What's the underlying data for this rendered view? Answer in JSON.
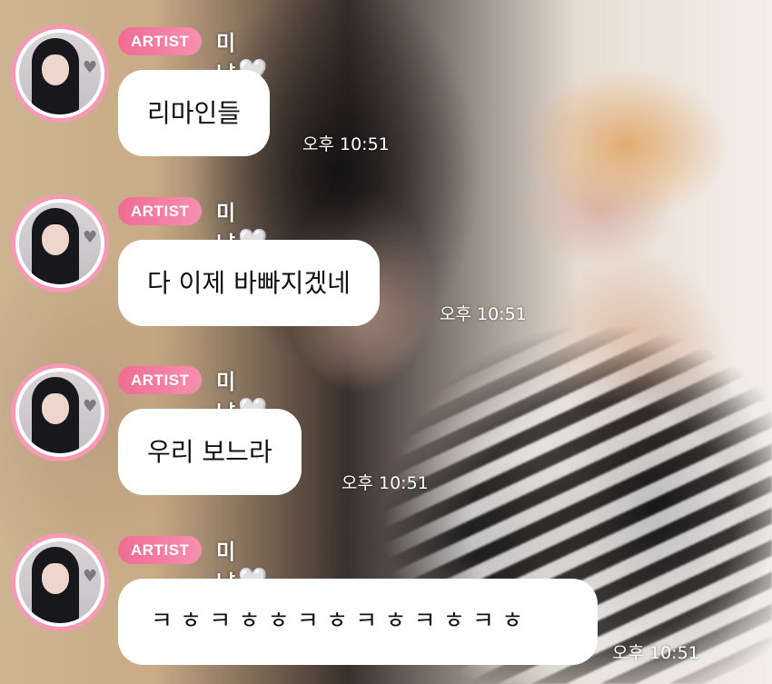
{
  "messages": [
    {
      "badge": "ARTIST",
      "sender": "미냥이",
      "heart": "🤍",
      "text": "리마인들",
      "time": "오후 10:51"
    },
    {
      "badge": "ARTIST",
      "sender": "미냥이",
      "heart": "🤍",
      "text": "다 이제 바빠지겠네",
      "time": "오후 10:51"
    },
    {
      "badge": "ARTIST",
      "sender": "미냥이",
      "heart": "🤍",
      "text": "우리 보느라",
      "time": "오후 10:51"
    },
    {
      "badge": "ARTIST",
      "sender": "미냥이",
      "heart": "🤍",
      "text": "ㅋ ㅎ ㅋ ㅎ ㅎ ㅋ ㅎ ㅋ ㅎ ㅋ ㅎ ㅋ ㅎ",
      "time": "오후 10:51"
    }
  ],
  "colors": {
    "badge": "#f06c93",
    "avatar_ring": "#f49ab4",
    "bubble": "#ffffff"
  }
}
